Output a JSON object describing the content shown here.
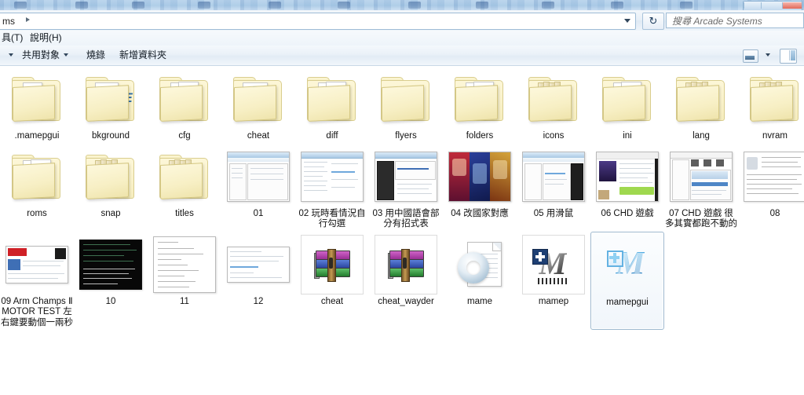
{
  "window": {
    "address": {
      "text": "ms",
      "separator_icon": "chevron-right-icon",
      "dropdown_icon": "chevron-down-icon"
    },
    "refresh_label": "↻",
    "search": {
      "placeholder": "搜尋 Arcade Systems"
    }
  },
  "menu": {
    "items": [
      {
        "label": "具(T)"
      },
      {
        "label": "說明(H)"
      }
    ]
  },
  "toolbar": {
    "organize_caret_icon": "chevron-down-icon",
    "items": [
      {
        "label": "共用對象",
        "has_caret": true
      },
      {
        "label": "燒錄",
        "has_caret": false
      },
      {
        "label": "新增資料夾",
        "has_caret": false
      }
    ],
    "view_button_icon": "view-layout-icon",
    "view_caret_icon": "chevron-down-icon",
    "preview_pane_icon": "preview-pane-icon"
  },
  "files": {
    "rows": [
      [
        {
          "name": ".mamepgui",
          "kind": "folder",
          "variant": "gear-doc"
        },
        {
          "name": "bkground",
          "kind": "folder",
          "variant": "mame-logo"
        },
        {
          "name": "cfg",
          "kind": "folder",
          "variant": "two-papers"
        },
        {
          "name": "cheat",
          "kind": "folder",
          "variant": "globe-doc"
        },
        {
          "name": "diff",
          "kind": "folder",
          "variant": "two-papers"
        },
        {
          "name": "flyers",
          "kind": "folder",
          "variant": "empty"
        },
        {
          "name": "folders",
          "kind": "folder",
          "variant": "two-papers"
        },
        {
          "name": "icons",
          "kind": "folder",
          "variant": "stack"
        },
        {
          "name": "ini",
          "kind": "folder",
          "variant": "two-papers"
        },
        {
          "name": "lang",
          "kind": "folder",
          "variant": "stack"
        },
        {
          "name": "nvram",
          "kind": "folder",
          "variant": "stack"
        }
      ],
      [
        {
          "name": "roms",
          "kind": "folder",
          "variant": "two-papers"
        },
        {
          "name": "snap",
          "kind": "folder",
          "variant": "stack"
        },
        {
          "name": "titles",
          "kind": "folder",
          "variant": "stack"
        },
        {
          "name": "01",
          "kind": "image",
          "variant": "ui-window"
        },
        {
          "name": "02 玩時看情況自行勾選",
          "kind": "image",
          "variant": "ui-list"
        },
        {
          "name": "03 用中國語會部分有招式表",
          "kind": "image",
          "variant": "ui-dark-list"
        },
        {
          "name": "04 改國家對應",
          "kind": "image",
          "variant": "poster"
        },
        {
          "name": "05 用滑鼠",
          "kind": "image",
          "variant": "ui-window"
        },
        {
          "name": "06 CHD 遊戲",
          "kind": "image",
          "variant": "web-page"
        },
        {
          "name": "07 CHD 遊戲 很多其實都跑不動的",
          "kind": "image",
          "variant": "ui-window"
        },
        {
          "name": "08",
          "kind": "image",
          "variant": "text-page"
        }
      ],
      [
        {
          "name": "09 Arm Champs Ⅱ MOTOR TEST 左右鍵要動個一兩秒",
          "kind": "image",
          "variant": "web-page"
        },
        {
          "name": "10",
          "kind": "image",
          "variant": "console-dark"
        },
        {
          "name": "11",
          "kind": "image",
          "variant": "text-page"
        },
        {
          "name": "12",
          "kind": "image",
          "variant": "web-page"
        },
        {
          "name": "cheat",
          "kind": "archive",
          "variant": "winrar"
        },
        {
          "name": "cheat_wayder",
          "kind": "archive",
          "variant": "winrar"
        },
        {
          "name": "mame",
          "kind": "config",
          "variant": "gear-page"
        },
        {
          "name": "mamep",
          "kind": "application",
          "variant": "mamep"
        },
        {
          "name": "mamepgui",
          "kind": "application",
          "variant": "mamepgui",
          "selected": true
        }
      ]
    ]
  },
  "colors": {
    "folder_yellow": "#f6edbe",
    "selection_border": "#9fb9cf",
    "accent_blue": "#4aa8e0",
    "chrome_gradient_top": "#f4f8fc"
  }
}
